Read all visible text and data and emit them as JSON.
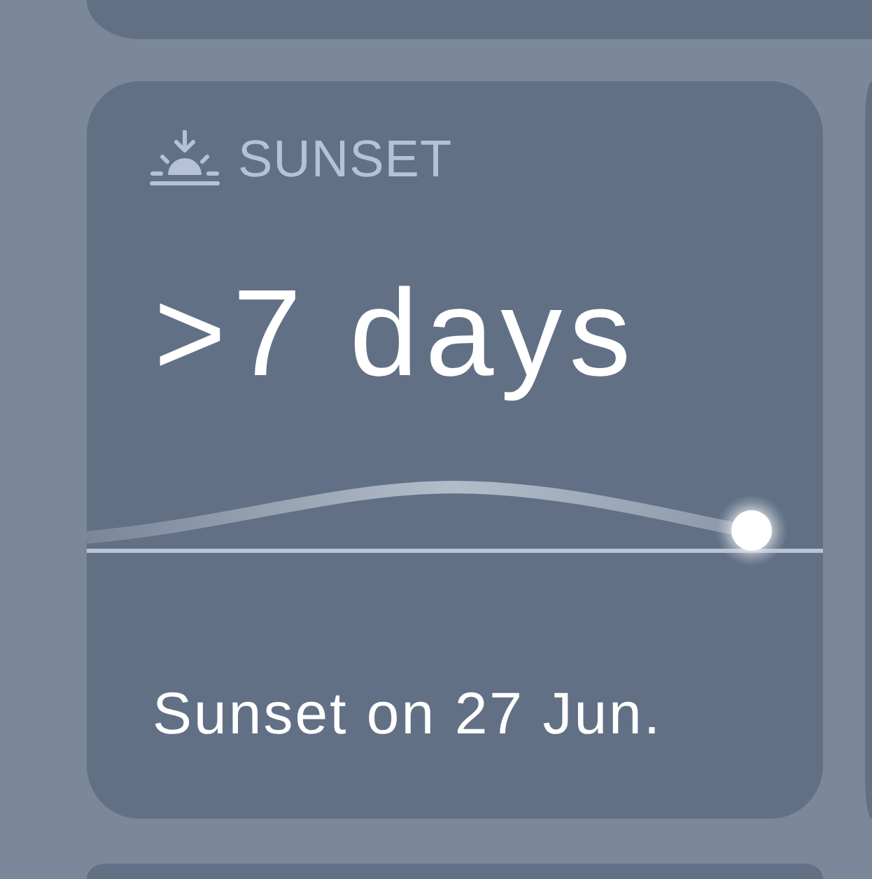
{
  "widget": {
    "header": {
      "label": "SUNSET"
    },
    "value": ">7 days",
    "footer": "Sunset on 27 Jun."
  }
}
